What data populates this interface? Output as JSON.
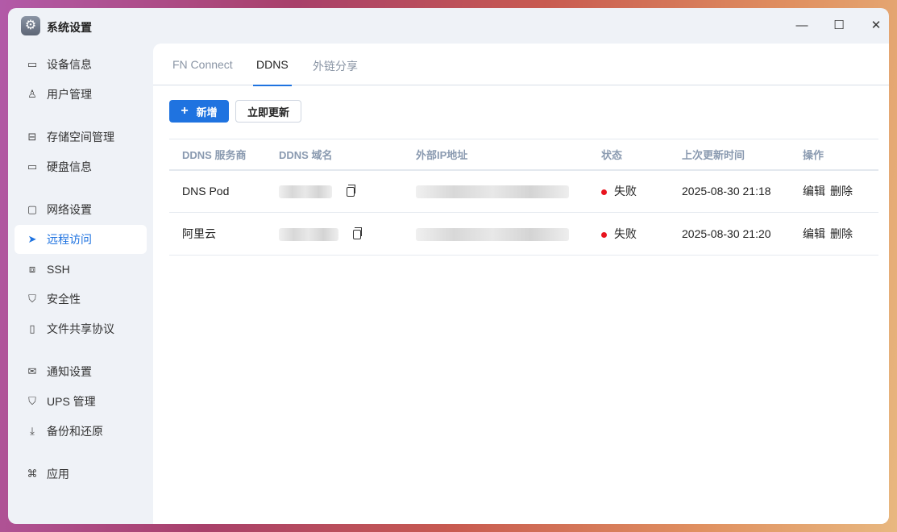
{
  "window": {
    "title": "系统设置"
  },
  "sidebar": {
    "items": [
      {
        "label": "设备信息",
        "icon": "drive-icon"
      },
      {
        "label": "用户管理",
        "icon": "users-icon"
      },
      {
        "label": "存储空间管理",
        "icon": "storage-icon"
      },
      {
        "label": "硬盘信息",
        "icon": "disk-icon"
      },
      {
        "label": "网络设置",
        "icon": "network-icon"
      },
      {
        "label": "远程访问",
        "icon": "send-icon"
      },
      {
        "label": "SSH",
        "icon": "code-icon"
      },
      {
        "label": "安全性",
        "icon": "shield-icon"
      },
      {
        "label": "文件共享协议",
        "icon": "file-icon"
      },
      {
        "label": "通知设置",
        "icon": "mail-icon"
      },
      {
        "label": "UPS 管理",
        "icon": "ups-shield-icon"
      },
      {
        "label": "备份和还原",
        "icon": "backup-icon"
      },
      {
        "label": "应用",
        "icon": "apps-icon"
      }
    ]
  },
  "tabs": [
    {
      "label": "FN Connect"
    },
    {
      "label": "DDNS"
    },
    {
      "label": "外链分享"
    }
  ],
  "toolbar": {
    "add_label": "新增",
    "update_label": "立即更新"
  },
  "table": {
    "headers": [
      "DDNS 服务商",
      "DDNS 域名",
      "外部IP地址",
      "状态",
      "上次更新时间",
      "操作"
    ],
    "rows": [
      {
        "provider": "DNS Pod",
        "status": "失败",
        "updated": "2025-08-30 21:18",
        "edit": "编辑",
        "delete": "删除"
      },
      {
        "provider": "阿里云",
        "status": "失败",
        "updated": "2025-08-30 21:20",
        "edit": "编辑",
        "delete": "删除"
      }
    ]
  },
  "colors": {
    "accent": "#1f73e0",
    "status_fail": "#e8141e"
  }
}
